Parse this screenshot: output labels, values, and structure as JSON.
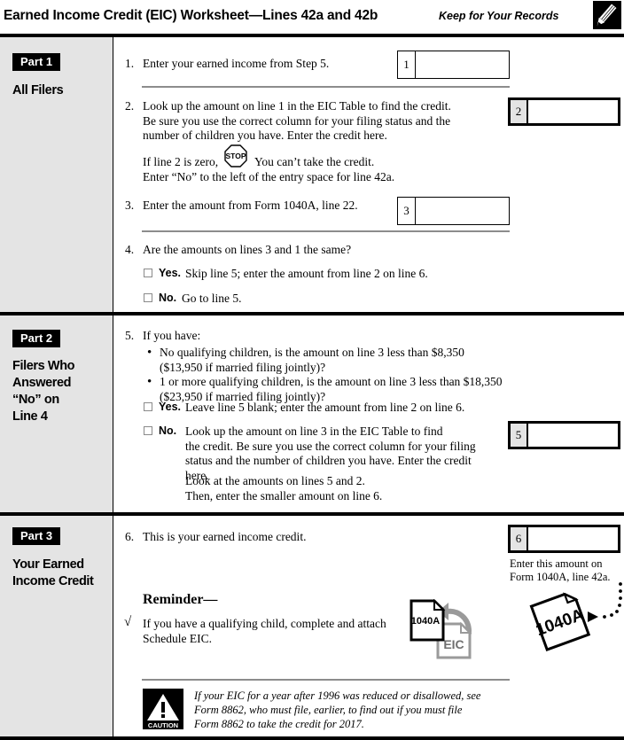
{
  "header": {
    "title": "Earned Income Credit (EIC) Worksheet—Lines 42a and 42b",
    "keep": "Keep for Your Records",
    "pencil_icon": "pencil-icon"
  },
  "parts": [
    {
      "tag": "Part 1",
      "subtitle": "All Filers"
    },
    {
      "tag": "Part 2",
      "subtitle": "Filers Who\nAnswered\n“No” on\nLine 4"
    },
    {
      "tag": "Part 3",
      "subtitle": "Your Earned\nIncome Credit"
    }
  ],
  "lines": {
    "n1": "1.",
    "l1_text": "Enter your earned income from Step 5.",
    "n2": "2.",
    "l2_text": "Look up the amount on line 1 in the EIC Table to find the credit.\nBe sure you use the correct column for your filing status and the\nnumber of children you have. Enter the credit here.",
    "l2_stop_a": "If line 2 is zero,",
    "l2_stop_icon": "stop-sign-icon",
    "l2_stop_b": "You can’t take the credit.",
    "l2_stop_c": "Enter “No” to the left of the entry space for line 42a.",
    "n3": "3.",
    "l3_text": "Enter the amount from Form 1040A, line 22.",
    "n4": "4.",
    "l4_text": "Are the amounts on lines 3 and 1 the same?",
    "l4_yes_label": "Yes.",
    "l4_yes_text": "Skip line 5; enter the amount from line 2 on line 6.",
    "l4_no_label": "No.",
    "l4_no_text": "Go to line 5.",
    "n5": "5.",
    "l5_text": "If you have:",
    "l5_b1": "No qualifying children, is the amount on line 3 less than $8,350\n($13,950 if married filing jointly)?",
    "l5_b2": "1 or more qualifying children, is the amount on line 3 less than $18,350\n($23,950 if married filing jointly)?",
    "l5_yes_label": "Yes.",
    "l5_yes_text": "Leave line 5 blank; enter the amount from line 2 on line 6.",
    "l5_no_label": "No.",
    "l5_no_text": "Look up the amount on line 3 in the EIC Table to find\nthe credit. Be sure you use the correct column for your filing\nstatus and the number of children you have. Enter the credit here.",
    "l5_note": "Look at the amounts on lines 5 and 2.\nThen, enter the smaller amount on line 6.",
    "n6": "6.",
    "l6_text": "This is your earned income credit."
  },
  "boxes": {
    "b1": "1",
    "b2": "2",
    "b3": "3",
    "b5": "5",
    "b6": "6"
  },
  "part3": {
    "enter_note": "Enter this amount on\nForm 1040A, line 42a.",
    "form_icon_label": "1040A",
    "reminder_heading": "Reminder—",
    "reminder_check": "√",
    "reminder_text": "If you have a qualifying child, complete and attach\nSchedule EIC.",
    "eic_icon_a": "1040A",
    "eic_icon_b": "EIC",
    "caution_icon": "caution-icon",
    "caution_label": "CAUTION",
    "caution_text": "If your EIC for a year after 1996 was reduced or disallowed, see\nForm 8862, who must file, earlier, to find out if you must file\nForm 8862 to take the credit for 2017."
  },
  "colors": {
    "sidebar_gray": "#e4e4e4",
    "rule_gray": "#8c8c8c",
    "black": "#000000"
  }
}
